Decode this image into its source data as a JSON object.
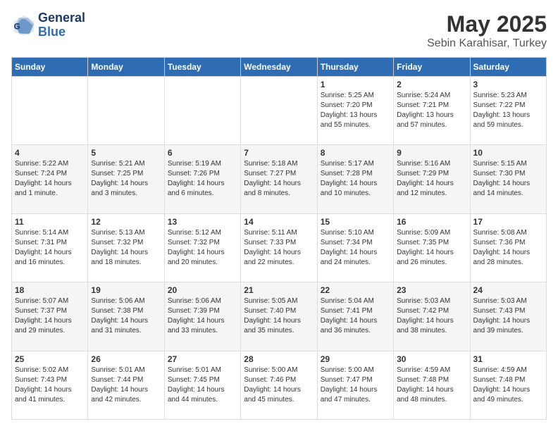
{
  "header": {
    "logo_line1": "General",
    "logo_line2": "Blue",
    "main_title": "May 2025",
    "subtitle": "Sebin Karahisar, Turkey"
  },
  "weekdays": [
    "Sunday",
    "Monday",
    "Tuesday",
    "Wednesday",
    "Thursday",
    "Friday",
    "Saturday"
  ],
  "weeks": [
    [
      {
        "day": "",
        "info": ""
      },
      {
        "day": "",
        "info": ""
      },
      {
        "day": "",
        "info": ""
      },
      {
        "day": "",
        "info": ""
      },
      {
        "day": "1",
        "info": "Sunrise: 5:25 AM\nSunset: 7:20 PM\nDaylight: 13 hours\nand 55 minutes."
      },
      {
        "day": "2",
        "info": "Sunrise: 5:24 AM\nSunset: 7:21 PM\nDaylight: 13 hours\nand 57 minutes."
      },
      {
        "day": "3",
        "info": "Sunrise: 5:23 AM\nSunset: 7:22 PM\nDaylight: 13 hours\nand 59 minutes."
      }
    ],
    [
      {
        "day": "4",
        "info": "Sunrise: 5:22 AM\nSunset: 7:24 PM\nDaylight: 14 hours\nand 1 minute."
      },
      {
        "day": "5",
        "info": "Sunrise: 5:21 AM\nSunset: 7:25 PM\nDaylight: 14 hours\nand 3 minutes."
      },
      {
        "day": "6",
        "info": "Sunrise: 5:19 AM\nSunset: 7:26 PM\nDaylight: 14 hours\nand 6 minutes."
      },
      {
        "day": "7",
        "info": "Sunrise: 5:18 AM\nSunset: 7:27 PM\nDaylight: 14 hours\nand 8 minutes."
      },
      {
        "day": "8",
        "info": "Sunrise: 5:17 AM\nSunset: 7:28 PM\nDaylight: 14 hours\nand 10 minutes."
      },
      {
        "day": "9",
        "info": "Sunrise: 5:16 AM\nSunset: 7:29 PM\nDaylight: 14 hours\nand 12 minutes."
      },
      {
        "day": "10",
        "info": "Sunrise: 5:15 AM\nSunset: 7:30 PM\nDaylight: 14 hours\nand 14 minutes."
      }
    ],
    [
      {
        "day": "11",
        "info": "Sunrise: 5:14 AM\nSunset: 7:31 PM\nDaylight: 14 hours\nand 16 minutes."
      },
      {
        "day": "12",
        "info": "Sunrise: 5:13 AM\nSunset: 7:32 PM\nDaylight: 14 hours\nand 18 minutes."
      },
      {
        "day": "13",
        "info": "Sunrise: 5:12 AM\nSunset: 7:32 PM\nDaylight: 14 hours\nand 20 minutes."
      },
      {
        "day": "14",
        "info": "Sunrise: 5:11 AM\nSunset: 7:33 PM\nDaylight: 14 hours\nand 22 minutes."
      },
      {
        "day": "15",
        "info": "Sunrise: 5:10 AM\nSunset: 7:34 PM\nDaylight: 14 hours\nand 24 minutes."
      },
      {
        "day": "16",
        "info": "Sunrise: 5:09 AM\nSunset: 7:35 PM\nDaylight: 14 hours\nand 26 minutes."
      },
      {
        "day": "17",
        "info": "Sunrise: 5:08 AM\nSunset: 7:36 PM\nDaylight: 14 hours\nand 28 minutes."
      }
    ],
    [
      {
        "day": "18",
        "info": "Sunrise: 5:07 AM\nSunset: 7:37 PM\nDaylight: 14 hours\nand 29 minutes."
      },
      {
        "day": "19",
        "info": "Sunrise: 5:06 AM\nSunset: 7:38 PM\nDaylight: 14 hours\nand 31 minutes."
      },
      {
        "day": "20",
        "info": "Sunrise: 5:06 AM\nSunset: 7:39 PM\nDaylight: 14 hours\nand 33 minutes."
      },
      {
        "day": "21",
        "info": "Sunrise: 5:05 AM\nSunset: 7:40 PM\nDaylight: 14 hours\nand 35 minutes."
      },
      {
        "day": "22",
        "info": "Sunrise: 5:04 AM\nSunset: 7:41 PM\nDaylight: 14 hours\nand 36 minutes."
      },
      {
        "day": "23",
        "info": "Sunrise: 5:03 AM\nSunset: 7:42 PM\nDaylight: 14 hours\nand 38 minutes."
      },
      {
        "day": "24",
        "info": "Sunrise: 5:03 AM\nSunset: 7:43 PM\nDaylight: 14 hours\nand 39 minutes."
      }
    ],
    [
      {
        "day": "25",
        "info": "Sunrise: 5:02 AM\nSunset: 7:43 PM\nDaylight: 14 hours\nand 41 minutes."
      },
      {
        "day": "26",
        "info": "Sunrise: 5:01 AM\nSunset: 7:44 PM\nDaylight: 14 hours\nand 42 minutes."
      },
      {
        "day": "27",
        "info": "Sunrise: 5:01 AM\nSunset: 7:45 PM\nDaylight: 14 hours\nand 44 minutes."
      },
      {
        "day": "28",
        "info": "Sunrise: 5:00 AM\nSunset: 7:46 PM\nDaylight: 14 hours\nand 45 minutes."
      },
      {
        "day": "29",
        "info": "Sunrise: 5:00 AM\nSunset: 7:47 PM\nDaylight: 14 hours\nand 47 minutes."
      },
      {
        "day": "30",
        "info": "Sunrise: 4:59 AM\nSunset: 7:48 PM\nDaylight: 14 hours\nand 48 minutes."
      },
      {
        "day": "31",
        "info": "Sunrise: 4:59 AM\nSunset: 7:48 PM\nDaylight: 14 hours\nand 49 minutes."
      }
    ]
  ]
}
